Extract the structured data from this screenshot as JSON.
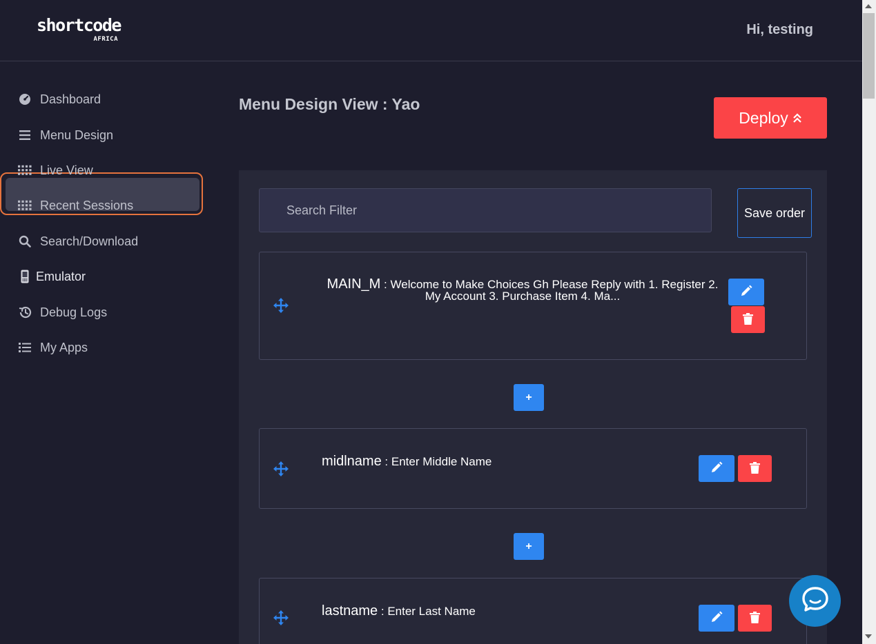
{
  "header": {
    "logo_main": "shortcode",
    "logo_sub": "AFRICA",
    "greeting": "Hi, testing"
  },
  "sidebar": {
    "items": [
      {
        "label": "Dashboard",
        "icon": "dashboard-gauge-icon"
      },
      {
        "label": "Menu Design",
        "icon": "hamburger-icon"
      },
      {
        "label": "Live View",
        "icon": "grid-dots-icon"
      },
      {
        "label": "Recent Sessions",
        "icon": "grid-dots-icon"
      },
      {
        "label": "Search/Download",
        "icon": "search-icon"
      },
      {
        "label": "Emulator",
        "icon": "mobile-phone-icon",
        "active": true
      },
      {
        "label": "Debug Logs",
        "icon": "history-icon"
      },
      {
        "label": "My Apps",
        "icon": "list-icon"
      }
    ]
  },
  "main": {
    "title": "Menu Design View : Yao",
    "deploy_label": "Deploy",
    "search_placeholder": "Search Filter",
    "save_order_label": "Save order",
    "add_label": "+",
    "menus": [
      {
        "key": "MAIN_M",
        "text": "Welcome to Make Choices Gh Please Reply with 1. Register 2. My Account 3. Purchase Item 4. Ma..."
      },
      {
        "key": "midlname",
        "text": "Enter Middle Name"
      },
      {
        "key": "lastname",
        "text": "Enter Last Name"
      }
    ]
  },
  "colors": {
    "background": "#1d1d2d",
    "panel": "#272838",
    "primary": "#2f86f0",
    "danger": "#fb4447",
    "highlight": "#e6733d"
  }
}
